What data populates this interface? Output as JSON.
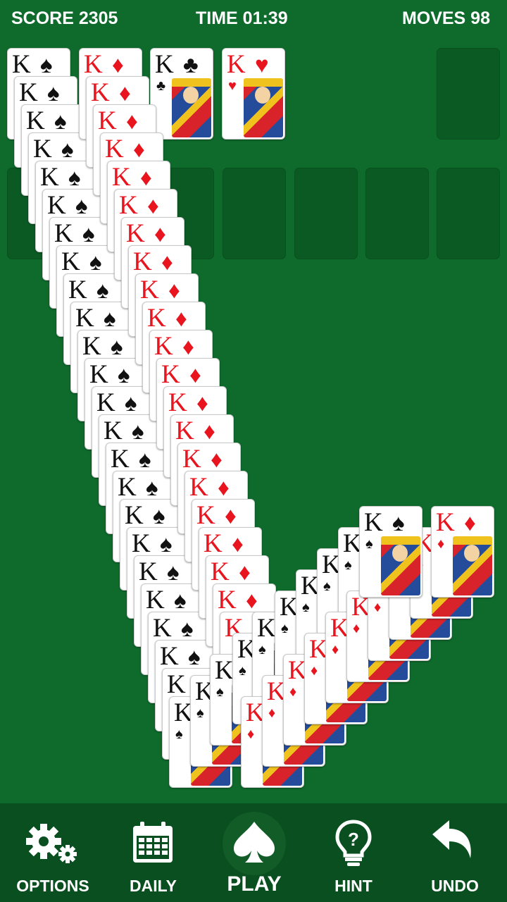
{
  "hud": {
    "score": "SCORE 2305",
    "time": "TIME 01:39",
    "moves": "MOVES 98"
  },
  "card": {
    "rank": "K",
    "spade": "♠",
    "diamond": "♦",
    "club": "♣",
    "heart": "♥"
  },
  "nav": {
    "options": "OPTIONS",
    "daily": "DAILY",
    "play": "PLAY",
    "hint": "HINT",
    "undo": "UNDO"
  },
  "colors": {
    "felt": "#0e6b2c",
    "bar": "#0a4f20",
    "red": "#e8141e",
    "black": "#111111"
  }
}
